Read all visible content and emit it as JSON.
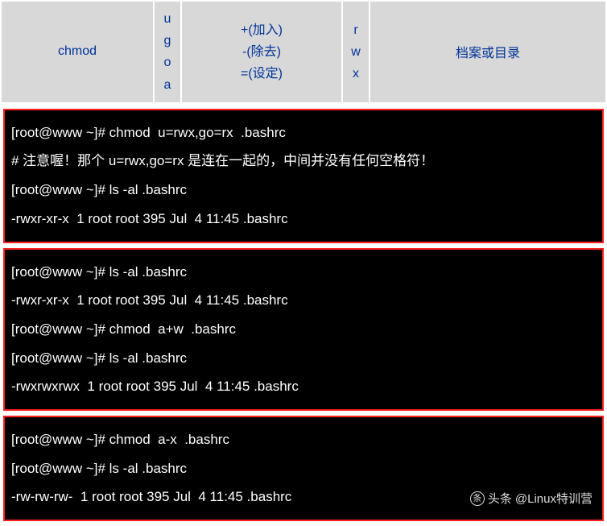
{
  "table": {
    "cmd": "chmod",
    "who": [
      "u",
      "g",
      "o",
      "a"
    ],
    "ops": [
      "+(加入)",
      "-(除去)",
      "=(设定)"
    ],
    "perms": [
      "r",
      "w",
      "x"
    ],
    "target": "档案或目录"
  },
  "term1": {
    "l1": "[root@www ~]# chmod  u=rwx,go=rx  .bashrc",
    "l2": "# 注意喔！那个 u=rwx,go=rx 是连在一起的，中间并没有任何空格符！",
    "l3": "[root@www ~]# ls -al .bashrc",
    "l4": "-rwxr-xr-x  1 root root 395 Jul  4 11:45 .bashrc"
  },
  "term2": {
    "l1": "[root@www ~]# ls -al .bashrc",
    "l2": "-rwxr-xr-x  1 root root 395 Jul  4 11:45 .bashrc",
    "l3": "[root@www ~]# chmod  a+w  .bashrc",
    "l4": "[root@www ~]# ls -al .bashrc",
    "l5": "-rwxrwxrwx  1 root root 395 Jul  4 11:45 .bashrc"
  },
  "term3": {
    "l1": "[root@www ~]# chmod  a-x  .bashrc",
    "l2": "[root@www ~]# ls -al .bashrc",
    "l3": "-rw-rw-rw-  1 root root 395 Jul  4 11:45 .bashrc"
  },
  "watermark": {
    "prefix": "头条",
    "handle": "@Linux特训营"
  }
}
